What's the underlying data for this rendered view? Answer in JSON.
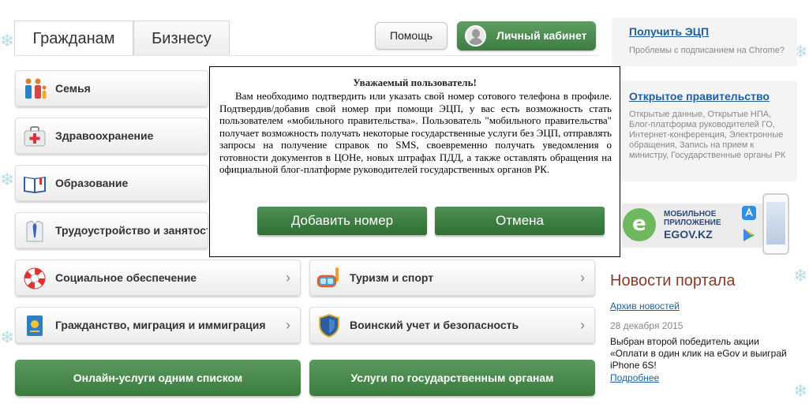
{
  "tabs": [
    {
      "label": "Гражданам",
      "active": true
    },
    {
      "label": "Бизнесу",
      "active": false
    }
  ],
  "header": {
    "help_label": "Помощь",
    "cabinet_label": "Личный кабинет"
  },
  "categories": [
    {
      "label": "Семья",
      "icon": "family-icon"
    },
    {
      "label": "Здравоохранение",
      "icon": "first-aid-kit-icon"
    },
    {
      "label": "Образование",
      "icon": "book-icon"
    },
    {
      "label": "Трудоустройство и занятость",
      "icon": "shirt-tie-icon"
    },
    {
      "label": "Социальное обеспечение",
      "icon": "lifebuoy-icon"
    },
    {
      "label": "Туризм и спорт",
      "icon": "diving-mask-icon"
    },
    {
      "label": "Гражданство, миграция и иммиграция",
      "icon": "passport-icon"
    },
    {
      "label": "Воинский учет и безопасность",
      "icon": "shield-icon"
    }
  ],
  "bottom_buttons": {
    "online_list": "Онлайн-услуги одним списком",
    "by_agency": "Услуги по государственным органам"
  },
  "sidebar": {
    "ecp_link": "Получить ЭЦП",
    "ecp_sub": "Проблемы с подписанием на Chrome?",
    "open_gov_link": "Открытое правительство",
    "open_gov_sub": "Открытые данные, Открытые НПА, Блог-платформа руководителей ГО, Интернет-конференция, Электронные обращения, Запись на прием к министру, Государственные органы РК",
    "app_label": "МОБИЛЬНОЕ ПРИЛОЖЕНИЕ",
    "app_site": "EGOV.KZ"
  },
  "news": {
    "title": "Новости портала",
    "archive": "Архив новостей",
    "date": "28 декабря 2015",
    "text": "Выбран второй победитель акции «Оплати в один клик на eGov и выиграй iPhone 6S!",
    "more": "Подробнее"
  },
  "modal": {
    "title": "Уважаемый пользователь!",
    "body": "Вам необходимо подтвердить или указать свой номер сотового телефона в профиле. Подтвердив/добавив свой номер при помощи ЭЦП, у вас есть возможность стать пользователем «мобильного правительства». Пользователь \"мобильного правительства\" получает возможность получать некоторые государственные услуги без ЭЦП, отправлять запросы на получение справок по SMS, своевременно получать уведомления о готовности документов в ЦОНе, новых штрафах ПДД, а также оставлять обращения на официальной блог-платформе руководителей государственных органов РК.",
    "add_button": "Добавить номер",
    "cancel_button": "Отмена"
  },
  "colors": {
    "green": "#3e7d42",
    "link": "#1f5fa0",
    "news_title": "#8a3a2a"
  }
}
